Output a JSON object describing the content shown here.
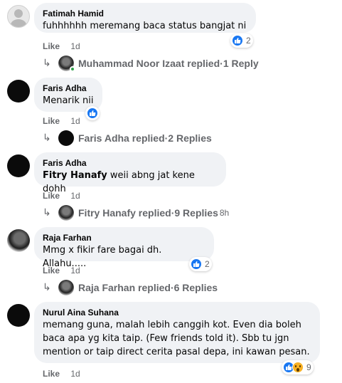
{
  "comments": [
    {
      "author": "Fatimah Hamid",
      "text": "fuhhhhhh meremang baca status bangjat ni",
      "reaction_count": "2",
      "like_label": "Like",
      "time": "1d",
      "replies": {
        "names": "Muhammad Noor Izaat replied",
        "sep": " · ",
        "count": "1 Reply"
      }
    },
    {
      "author": "Faris Adha",
      "text": "Menarik nii",
      "like_label": "Like",
      "time": "1d",
      "replies": {
        "names": "Faris Adha replied",
        "sep": " · ",
        "count": "2 Replies"
      }
    },
    {
      "author": "Faris Adha",
      "mention": "Fitry Hanafy",
      "text": " weii abng jat kene dohh",
      "like_label": "Like",
      "time": "1d",
      "replies": {
        "names": "Fitry Hanafy replied",
        "sep": " · ",
        "count": "9 Replies",
        "time": "8h"
      }
    },
    {
      "author": "Raja Farhan",
      "text": "Mmg x fikir fare bagai dh. Allahu.....",
      "reaction_count": "2",
      "like_label": "Like",
      "time": "1d",
      "replies": {
        "names": "Raja Farhan replied",
        "sep": " · ",
        "count": "6 Replies"
      }
    },
    {
      "author": "Nurul Aina Suhana",
      "text_lines": [
        "memang guna, malah lebih canggih kot. Even dia boleh",
        "baca apa yg kita taip. (Few friends told it). Sbb tu jgn",
        "mention or taip direct cerita pasal depa, ini kawan pesan."
      ],
      "reaction_count": "9",
      "like_label": "Like",
      "time": "1d"
    }
  ],
  "icons": {
    "reply_arrow": "reply-arrow-icon",
    "like_reaction": "like-reaction-icon",
    "wow_reaction": "wow-reaction-icon"
  },
  "colors": {
    "like_blue": "#1877f2",
    "bubble_bg": "#f0f2f5",
    "meta_gray": "#65676b",
    "online_green": "#31a24c"
  }
}
